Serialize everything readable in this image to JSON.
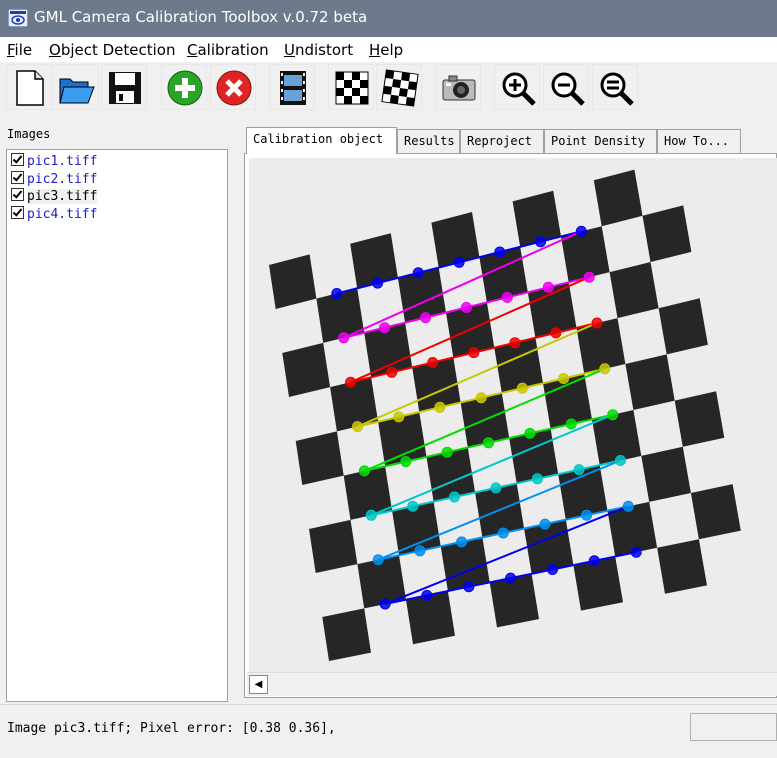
{
  "window": {
    "title": "GML Camera Calibration Toolbox  v.0.72 beta"
  },
  "menu": [
    {
      "label": "File",
      "mnemonic": "F",
      "rest": "ile"
    },
    {
      "label": "Object Detection",
      "mnemonic": "O",
      "rest": "bject Detection"
    },
    {
      "label": "Calibration",
      "mnemonic": "C",
      "rest": "alibration"
    },
    {
      "label": "Undistort",
      "mnemonic": "U",
      "rest": "ndistort"
    },
    {
      "label": "Help",
      "mnemonic": "H",
      "rest": "elp"
    }
  ],
  "toolbar": {
    "buttons": [
      "new-file-icon",
      "open-folder-icon",
      "save-disk-icon",
      "add-green-icon",
      "remove-red-icon",
      "film-strip-icon",
      "checkerboard-icon",
      "checkerboard-alt-icon",
      "camera-icon",
      "zoom-in-icon",
      "zoom-out-icon",
      "zoom-fit-icon"
    ]
  },
  "images_panel": {
    "label": "Images",
    "items": [
      {
        "name": "pic1.tiff",
        "checked": true,
        "selected": false
      },
      {
        "name": "pic2.tiff",
        "checked": true,
        "selected": false
      },
      {
        "name": "pic3.tiff",
        "checked": true,
        "selected": true
      },
      {
        "name": "pic4.tiff",
        "checked": true,
        "selected": false
      }
    ]
  },
  "tabs": [
    {
      "label": "Calibration object",
      "active": true
    },
    {
      "label": "Results",
      "active": false
    },
    {
      "label": "Reproject",
      "active": false
    },
    {
      "label": "Point Density",
      "active": false
    },
    {
      "label": "How To...",
      "active": false
    }
  ],
  "status": {
    "text": "Image pic3.tiff; Pixel error: [0.38  0.36],"
  },
  "colors": {
    "row_colors": [
      "#0000ee",
      "#ee00ee",
      "#ee0000",
      "#c8c800",
      "#00dd00",
      "#00c8c8",
      "#0090ee",
      "#0000ee"
    ]
  }
}
